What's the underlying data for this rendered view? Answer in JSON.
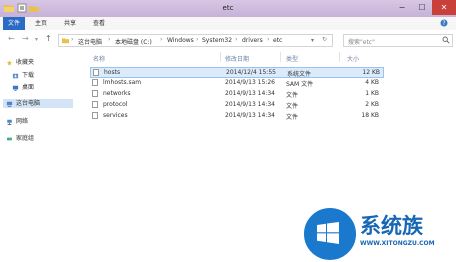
{
  "window": {
    "title": "etc"
  },
  "titlebar": {
    "minimize": "−",
    "maximize": "☐",
    "close": "✕"
  },
  "ribbon": {
    "tabs": [
      "文件",
      "主页",
      "共享",
      "查看"
    ]
  },
  "address": {
    "crumbs": [
      "这台电脑",
      "本地磁盘 (C:)",
      "Windows",
      "System32",
      "drivers",
      "etc"
    ],
    "search_placeholder": "搜索\"etc\""
  },
  "nav": {
    "favorites": "收藏夹",
    "downloads": "下载",
    "desktop": "桌面",
    "this_pc": "这台电脑",
    "network": "网络",
    "homegroup": "家庭组"
  },
  "columns": {
    "name": "名称",
    "modified": "修改日期",
    "type": "类型",
    "size": "大小"
  },
  "files": [
    {
      "name": "hosts",
      "modified": "2014/12/4 15:55",
      "type": "系统文件",
      "size": "12 KB"
    },
    {
      "name": "lmhosts.sam",
      "modified": "2014/9/13 15:26",
      "type": "SAM 文件",
      "size": "4 KB"
    },
    {
      "name": "networks",
      "modified": "2014/9/13 14:34",
      "type": "文件",
      "size": "1 KB"
    },
    {
      "name": "protocol",
      "modified": "2014/9/13 14:34",
      "type": "文件",
      "size": "2 KB"
    },
    {
      "name": "services",
      "modified": "2014/9/13 14:34",
      "type": "文件",
      "size": "18 KB"
    }
  ],
  "watermark": {
    "text": "系统族",
    "url": "WWW.XITONGZU.COM"
  },
  "colors": {
    "file_tab": "#2a6ac4",
    "close": "#c9403a",
    "selected_row": "#dcebfc",
    "watermark": "#1767b5"
  }
}
